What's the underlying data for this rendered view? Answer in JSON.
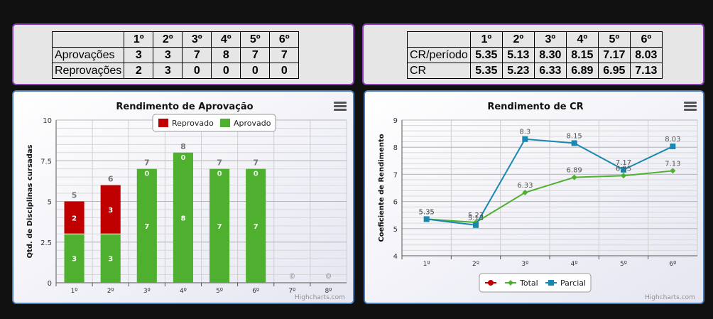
{
  "tables": {
    "approvals": {
      "headers": [
        "",
        "1º",
        "2º",
        "3º",
        "4º",
        "5º",
        "6º"
      ],
      "rows": [
        {
          "label": "Aprovações",
          "values": [
            "3",
            "3",
            "7",
            "8",
            "7",
            "7"
          ]
        },
        {
          "label": "Reprovações",
          "values": [
            "2",
            "3",
            "0",
            "0",
            "0",
            "0"
          ]
        }
      ]
    },
    "cr": {
      "headers": [
        "",
        "1º",
        "2º",
        "3º",
        "4º",
        "5º",
        "6º"
      ],
      "rows": [
        {
          "label": "CR/período",
          "values": [
            "5.35",
            "5.13",
            "8.30",
            "8.15",
            "7.17",
            "8.03"
          ]
        },
        {
          "label": "CR",
          "values": [
            "5.35",
            "5.23",
            "6.33",
            "6.89",
            "6.95",
            "7.13"
          ]
        }
      ]
    }
  },
  "credits": "Highcharts.com",
  "chart_data": [
    {
      "type": "bar",
      "stacked": true,
      "title": "Rendimento de Aprovação",
      "ylabel": "Qtd. de Disciplinas cursadas",
      "xlabel": "",
      "categories": [
        "1º",
        "2º",
        "3º",
        "4º",
        "5º",
        "6º",
        "7º",
        "8º"
      ],
      "ylim": [
        0,
        10
      ],
      "yticks": [
        "0",
        "2.5",
        "5",
        "7.5",
        "10"
      ],
      "ytick_values": [
        0,
        2.5,
        5,
        7.5,
        10
      ],
      "series": [
        {
          "name": "Reprovado",
          "color": "#c00000",
          "values": [
            2,
            3,
            0,
            0,
            0,
            0,
            0,
            0
          ]
        },
        {
          "name": "Aprovado",
          "color": "#4fb030",
          "values": [
            3,
            3,
            7,
            8,
            7,
            7,
            0,
            0
          ]
        }
      ],
      "totals": [
        5,
        6,
        7,
        8,
        7,
        7,
        0,
        0
      ],
      "legend_position": "top-center",
      "grid": true
    },
    {
      "type": "line",
      "title": "Rendimento de CR",
      "ylabel": "Coeficiente de Rendimento",
      "xlabel": "",
      "categories": [
        "1º",
        "2º",
        "3º",
        "4º",
        "5º",
        "6º"
      ],
      "ylim": [
        4,
        9
      ],
      "yticks": [
        "4",
        "5",
        "6",
        "7",
        "8",
        "9"
      ],
      "ytick_values": [
        4,
        5,
        6,
        7,
        8,
        9
      ],
      "legend_items": [
        "",
        "Total",
        "Parcial"
      ],
      "legend_colors": [
        "#c00000",
        "#4fb030",
        "#1a87b0"
      ],
      "series": [
        {
          "name": "Total",
          "color": "#4fb030",
          "marker": "diamond",
          "values": [
            5.35,
            5.23,
            6.33,
            6.89,
            6.95,
            7.13
          ]
        },
        {
          "name": "Parcial",
          "color": "#1a87b0",
          "marker": "square",
          "values": [
            5.35,
            5.13,
            8.3,
            8.15,
            7.17,
            8.03
          ]
        }
      ],
      "labels_total": [
        "5.35",
        "5.23",
        "6.33",
        "6.89",
        "6.95",
        "7.13"
      ],
      "labels_parcial": [
        "5.35",
        "5.13",
        "8.3",
        "8.15",
        "7.17",
        "8.03"
      ],
      "legend_position": "bottom-center",
      "grid": true
    }
  ]
}
